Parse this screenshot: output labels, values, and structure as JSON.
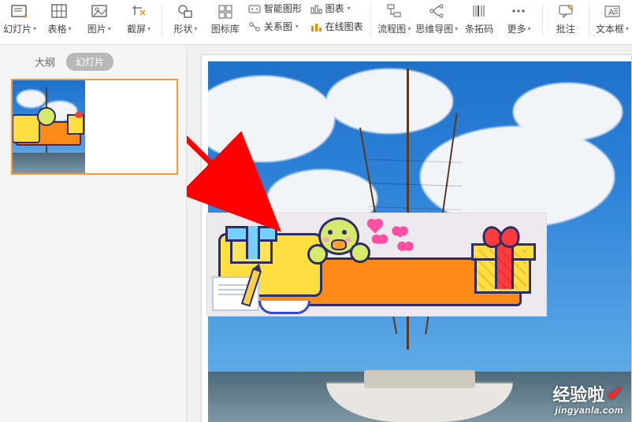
{
  "ribbon": {
    "new_slide": "幻灯片",
    "table": "表格",
    "picture": "图片",
    "screenshot": "截屏",
    "shapes": "形状",
    "icons": "图标库",
    "smart_art": "智能图形",
    "relation": "关系图",
    "chart": "图表",
    "online_chart": "在线图表",
    "flowchart": "流程图",
    "mindmap": "思维导图",
    "barcode": "条拓码",
    "more": "更多",
    "comment": "批注",
    "textbox": "文本框"
  },
  "sidebar": {
    "tab_outline": "大纲",
    "tab_slides": "幻灯片"
  },
  "watermark": {
    "line1": "经验啦",
    "line2": "jingyanla.com"
  }
}
